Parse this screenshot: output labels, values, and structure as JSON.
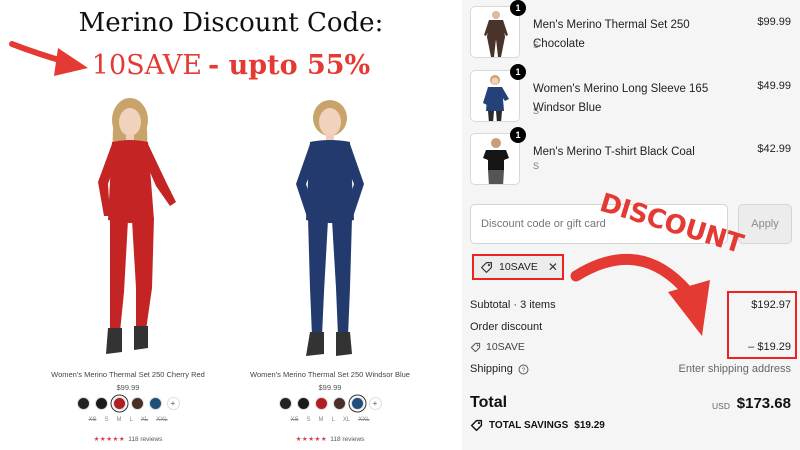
{
  "promo": {
    "title": "Merino Discount Code:",
    "code": "10SAVE",
    "upto": "- upto 55%",
    "products": [
      {
        "name": "Women's Merino Thermal Set 250 Cherry Red",
        "price": "$99.99",
        "outfit_color": "#c42424",
        "swatches": [
          "#222222",
          "#1a1a1a",
          "#b01e22",
          "#4a2e28",
          "#1f4e7a",
          "+"
        ],
        "selected_swatch": 2,
        "sizes": [
          "XS",
          "S",
          "M",
          "L",
          "XL",
          "XXL"
        ],
        "sizes_out": [
          0,
          4,
          5
        ],
        "stars": "★★★★★",
        "reviews": "118 reviews"
      },
      {
        "name": "Women's Merino Thermal Set 250 Windsor Blue",
        "price": "$99.99",
        "outfit_color": "#223a6e",
        "swatches": [
          "#222222",
          "#1a1a1a",
          "#b01e22",
          "#4a2e28",
          "#1f4e7a",
          "+"
        ],
        "selected_swatch": 4,
        "sizes": [
          "XS",
          "S",
          "M",
          "L",
          "XL",
          "XXL"
        ],
        "sizes_out": [
          0,
          5
        ],
        "stars": "★★★★★",
        "reviews": "118 reviews"
      }
    ]
  },
  "cart": {
    "items": [
      {
        "qty": "1",
        "name": "Men's Merino Thermal Set 250 Chocolate",
        "variant": "S",
        "price": "$99.99",
        "color": "#4a3328"
      },
      {
        "qty": "1",
        "name": "Women's Merino Long Sleeve 165 Windsor Blue",
        "variant": "S",
        "price": "$49.99",
        "color": "#24417a"
      },
      {
        "qty": "1",
        "name": "Men's Merino T-shirt Black Coal",
        "variant": "S",
        "price": "$42.99",
        "color": "#161616"
      }
    ],
    "discount_placeholder": "Discount code or gift card",
    "apply_label": "Apply",
    "applied_code": "10SAVE",
    "subtotal_label": "Subtotal · 3 items",
    "subtotal_value": "$192.97",
    "order_discount_label": "Order discount",
    "discount_code": "10SAVE",
    "discount_value": "– $19.29",
    "shipping_label": "Shipping",
    "shipping_value": "Enter shipping address",
    "total_label": "Total",
    "currency": "USD",
    "total_value": "$173.68",
    "savings_label": "TOTAL SAVINGS",
    "savings_value": "$19.29"
  },
  "annotation": {
    "word": "DISCOUNT",
    "color": "#e43a33"
  }
}
